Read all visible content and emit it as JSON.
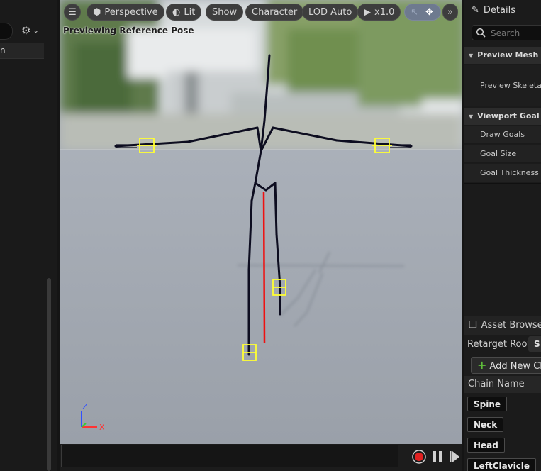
{
  "left_panel": {
    "row_label": "n",
    "settings_icon": "gear-icon"
  },
  "viewport": {
    "status_text": "Previewing Reference Pose",
    "toolbar": {
      "menu_icon": "hamburger-icon",
      "perspective_label": "Perspective",
      "lit_label": "Lit",
      "show_label": "Show",
      "character_label": "Character",
      "lod_label": "LOD Auto",
      "play_speed_label": "x1.0",
      "overflow_icon": "double-chevron-right-icon"
    },
    "axis": {
      "x": "X",
      "z": "Z"
    },
    "colors": {
      "bone": "#0d0d20",
      "goal": "#ffff33",
      "chain_highlight": "#ee1111"
    }
  },
  "playback": {
    "record_icon": "record-icon",
    "pause_icon": "pause-icon",
    "step_icon": "step-forward-icon"
  },
  "details": {
    "title": "Details",
    "search_placeholder": "Search",
    "sections": [
      {
        "title": "Preview Mesh",
        "rows": [
          "Preview Skeletal"
        ]
      },
      {
        "title": "Viewport Goal Se",
        "rows": [
          "Draw Goals",
          "Goal Size",
          "Goal Thickness"
        ]
      }
    ]
  },
  "asset_browser": {
    "title": "Asset Browse",
    "retarget_root_label": "Retarget Root:",
    "retarget_root_value": "S",
    "add_chain_label": "Add New Cl",
    "chain_column_header": "Chain Name",
    "chains": [
      "Spine",
      "Neck",
      "Head",
      "LeftClavicle"
    ]
  }
}
